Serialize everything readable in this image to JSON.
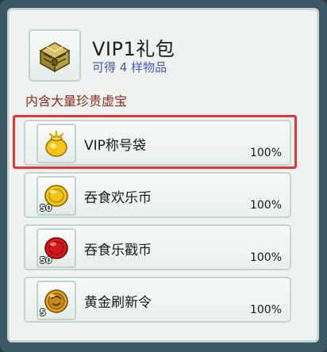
{
  "pack": {
    "title": "VIP1礼包",
    "subtitle": "可得 4 样物品",
    "icon": "treasure-chest-icon"
  },
  "section_label": "内含大量珍贵虚宝",
  "items": [
    {
      "name": "VIP称号袋",
      "chance": "100%",
      "quantity": "",
      "icon": "gold-pouch-icon"
    },
    {
      "name": "吞食欢乐币",
      "chance": "100%",
      "quantity": "50",
      "icon": "gold-coin-icon"
    },
    {
      "name": "吞食乐戳币",
      "chance": "100%",
      "quantity": "50",
      "icon": "red-coin-icon"
    },
    {
      "name": "黄金刷新令",
      "chance": "100%",
      "quantity": "5",
      "icon": "gold-token-icon"
    }
  ],
  "selected_index": 0,
  "colors": {
    "highlight": "#e8323c",
    "subtitle": "#4a56b8",
    "section_label": "#8b2b20"
  }
}
